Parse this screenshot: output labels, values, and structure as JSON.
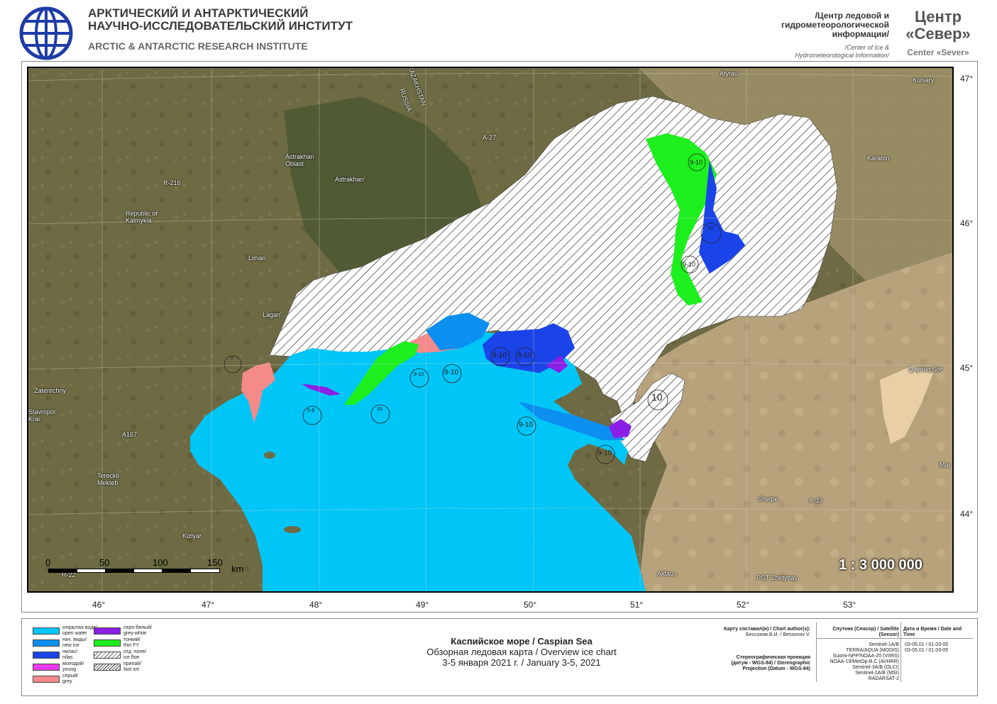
{
  "header": {
    "institute_ru_line1": "АРКТИЧЕСКИЙ И АНТАРКТИЧЕСКИЙ",
    "institute_ru_line2": "НАУЧНО-ИССЛЕДОВАТЕЛЬСКИЙ ИНСТИТУТ",
    "institute_en": "ARCTIC & ANTARCTIC RESEARCH INSTITUTE",
    "center_ru_line1": "/Центр ледовой и",
    "center_ru_line2": "гидрометеорологической",
    "center_ru_line3": "информации/",
    "center_en_line1": "/Center of Ice &",
    "center_en_line2": "Hydrometeorological Information/",
    "sever_ru_line1": "Центр",
    "sever_ru_line2": "«Север»",
    "sever_en": "Center «Sever»"
  },
  "map": {
    "latitudes": [
      "47°",
      "46°",
      "45°",
      "44°"
    ],
    "longitudes": [
      "46°",
      "47°",
      "48°",
      "49°",
      "50°",
      "51°",
      "52°",
      "53°"
    ],
    "scale_text": "1 : 3 000 000",
    "scalebar": {
      "ticks": [
        "0",
        "50",
        "100",
        "150"
      ],
      "unit": "km"
    },
    "place_labels": [
      "Atyrau",
      "Kulsary",
      "Karaton",
      "Astrakhan Oblast",
      "Astrakhan'",
      "Republic of Kalmykia",
      "Liman",
      "Lagan'",
      "Zaterechny",
      "Stavropol Krai",
      "Tereckli-Mekteb",
      "Kizlyar",
      "Shetpe",
      "Aktau",
      "PGT Zhetybay",
      "Qaydaq Sor",
      "KAZAKHSTAN",
      "RUSSIA",
      "A-27",
      "R-216",
      "A167",
      "R-22",
      "A-33",
      "Mar"
    ],
    "egg_codes": [
      "9-10",
      "10",
      "9-10",
      "9-10",
      "9-10",
      "9-10",
      "9-10",
      "9-10",
      "10",
      "5-6",
      "10",
      "9",
      "9-10"
    ],
    "colors": {
      "land": "#6b6a45",
      "open_water": "#00c6f8",
      "new_ice": "#0b8ff0",
      "nilas": "#1a44e8",
      "young": "#ee3bef",
      "grey": "#f58a8a",
      "grey_white": "#8c1fe6",
      "thin_fy": "#1eef1e",
      "fast_ice": "#ffffff"
    }
  },
  "legend": [
    {
      "ru": "открытая вода/",
      "en": "open water",
      "color": "#00c6f8",
      "pattern": "solid"
    },
    {
      "ru": "нач. виды/",
      "en": "new ice",
      "color": "#0b8ff0",
      "pattern": "solid"
    },
    {
      "ru": "нилас/",
      "en": "nilas",
      "color": "#1a44e8",
      "pattern": "solid"
    },
    {
      "ru": "молодой/",
      "en": "young",
      "color": "#ee3bef",
      "pattern": "solid"
    },
    {
      "ru": "серый/",
      "en": "grey",
      "color": "#f58a8a",
      "pattern": "solid"
    },
    {
      "ru": "серо-белый/",
      "en": "grey-white",
      "color": "#8c1fe6",
      "pattern": "solid"
    },
    {
      "ru": "тонкий/",
      "en": "thin FY",
      "color": "#1eef1e",
      "pattern": "solid"
    },
    {
      "ru": "отд. поле/",
      "en": "ice floe",
      "color": "#ffffff",
      "pattern": "floe"
    },
    {
      "ru": "припай/",
      "en": "fast ice",
      "color": "#ffffff",
      "pattern": "hatch"
    }
  ],
  "title": {
    "line1": "Каспийское море / Caspian Sea",
    "line2": "Обзорная ледовая карта / Overview ice chart",
    "line3": "3-5 января 2021 г. / January 3-5, 2021"
  },
  "authors": {
    "label": "Карту составил(и) / Chart author(s):",
    "names": "Бессонов В.И. / Bessonov V."
  },
  "projection": {
    "line1": "Стереографическая проекция",
    "line2": "(датум - WGS-84) / Stereographic",
    "line3": "Projection (Datum - WGS-84)"
  },
  "sources": {
    "header_sat": "Спутник (Сенсор) / Satellite (Sensor)",
    "header_date": "Дата и Время / Date and Time",
    "rows": [
      {
        "sat": "Sentinel-1A/B",
        "date": "03-05.01 / 01.03-05"
      },
      {
        "sat": "TERRA/AQUA (MODIS)",
        "date": "03-05.01 / 01.03-05"
      },
      {
        "sat": "Suomi-NPP/NOAA-20 (VIIRS)",
        "date": ""
      },
      {
        "sat": "NOAA-19/MetOp-B,C (AVHRR)",
        "date": ""
      },
      {
        "sat": "Sentinel-3A/B (OLCI)",
        "date": ""
      },
      {
        "sat": "Sentinel-2A/B (MSI)",
        "date": ""
      },
      {
        "sat": "RADARSAT-2",
        "date": ""
      }
    ]
  }
}
